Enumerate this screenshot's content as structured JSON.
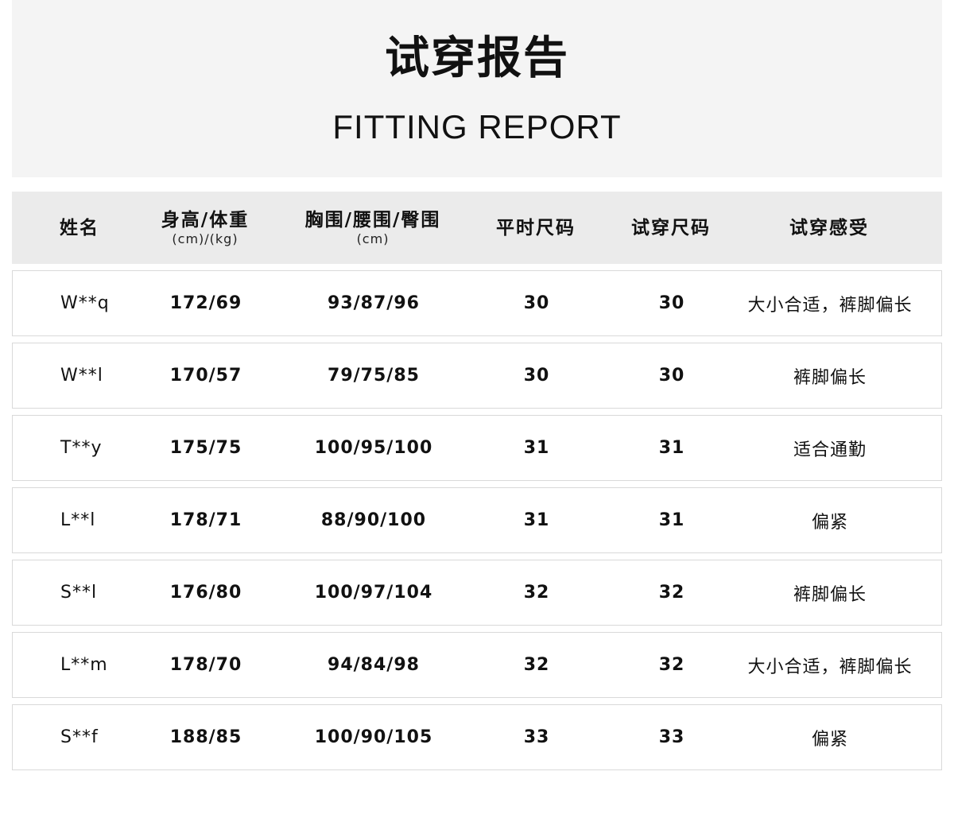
{
  "banner": {
    "title_cn": "试穿报告",
    "title_en": "FITTING REPORT"
  },
  "table": {
    "headers": [
      {
        "main": "姓名",
        "sub": ""
      },
      {
        "main": "身高/体重",
        "sub": "(cm)/(kg)"
      },
      {
        "main": "胸围/腰围/臀围",
        "sub": "(cm)"
      },
      {
        "main": "平时尺码",
        "sub": ""
      },
      {
        "main": "试穿尺码",
        "sub": ""
      },
      {
        "main": "试穿感受",
        "sub": ""
      }
    ],
    "rows": [
      [
        "W**q",
        "172/69",
        "93/87/96",
        "30",
        "30",
        "大小合适，裤脚偏长"
      ],
      [
        "W**l",
        "170/57",
        "79/75/85",
        "30",
        "30",
        "裤脚偏长"
      ],
      [
        "T**y",
        "175/75",
        "100/95/100",
        "31",
        "31",
        "适合通勤"
      ],
      [
        "L**l",
        "178/71",
        "88/90/100",
        "31",
        "31",
        "偏紧"
      ],
      [
        "S**l",
        "176/80",
        "100/97/104",
        "32",
        "32",
        "裤脚偏长"
      ],
      [
        "L**m",
        "178/70",
        "94/84/98",
        "32",
        "32",
        "大小合适，裤脚偏长"
      ],
      [
        "S**f",
        "188/85",
        "100/90/105",
        "33",
        "33",
        "偏紧"
      ]
    ]
  },
  "colors": {
    "banner_bg": "#f4f4f4",
    "header_bg": "#ebebeb",
    "row_border": "#d9d9d9",
    "text": "#111111"
  }
}
